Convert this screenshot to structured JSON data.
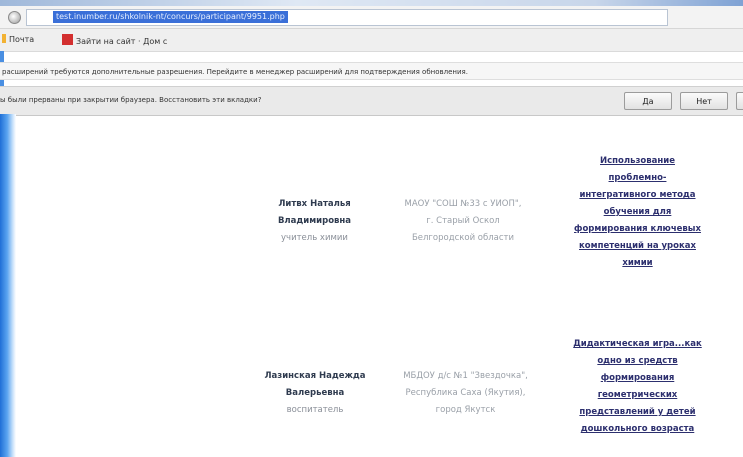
{
  "browser": {
    "address_url": "test.inumber.ru/shkolnik-nt/concurs/participant/9951.php",
    "bookmarks": [
      "Почта",
      "Зайти на сайт · Дом с"
    ],
    "extension_notice": "расширений требуются дополнительные разрешения. Перейдите в менеджер расширений для подтверждения обновления.",
    "restore_prompt": "ы были прерваны при закрытии браузера. Восстановить эти вкладки?",
    "restore_buttons": [
      "Да",
      "Нет"
    ]
  },
  "entries": [
    {
      "name_line1": "Литвх Наталья",
      "name_line2": "Владимировна",
      "role": "учитель химии",
      "org_lines": [
        "МАОУ \"СОШ №33 с УИОП\",",
        "г. Старый Оскол",
        "Белгородской области"
      ],
      "topic_lines": [
        "Использование",
        "проблемно-",
        "интегративного метода",
        "обучения для",
        "формирования ключевых",
        "компетенций на уроках",
        "химии"
      ]
    },
    {
      "name_line1": "Лазинская Надежда",
      "name_line2": "Валерьевна",
      "role": "воспитатель",
      "org_lines": [
        "МБДОУ д/с №1 \"Звездочка\",",
        "Республика Саха (Якутия),",
        "город Якутск"
      ],
      "topic_lines": [
        "Дидактическая игра...как",
        "одно из средств",
        "формирования",
        "геометрических",
        "представлений у детей",
        "дошкольного возраста"
      ]
    }
  ]
}
